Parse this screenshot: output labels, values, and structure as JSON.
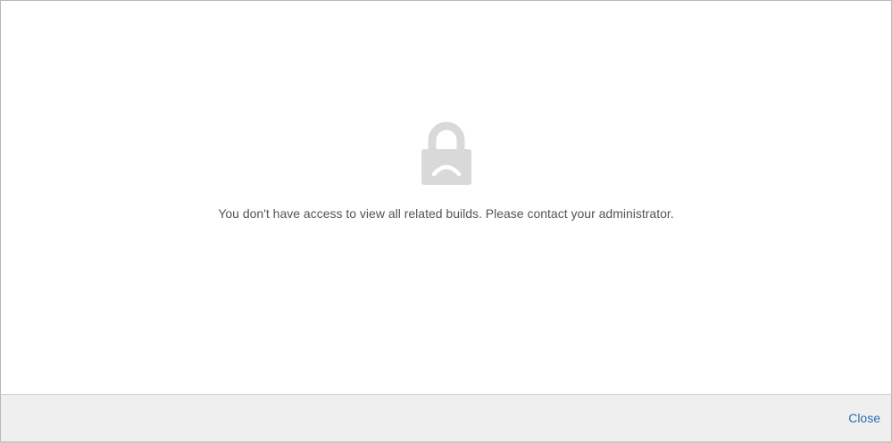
{
  "dialog": {
    "message": "You don't have access to view all related builds. Please contact your administrator.",
    "icon": "lock-sad-icon",
    "icon_color": "#d9d9d9"
  },
  "footer": {
    "close_label": "Close",
    "link_color": "#2a6fb0"
  }
}
